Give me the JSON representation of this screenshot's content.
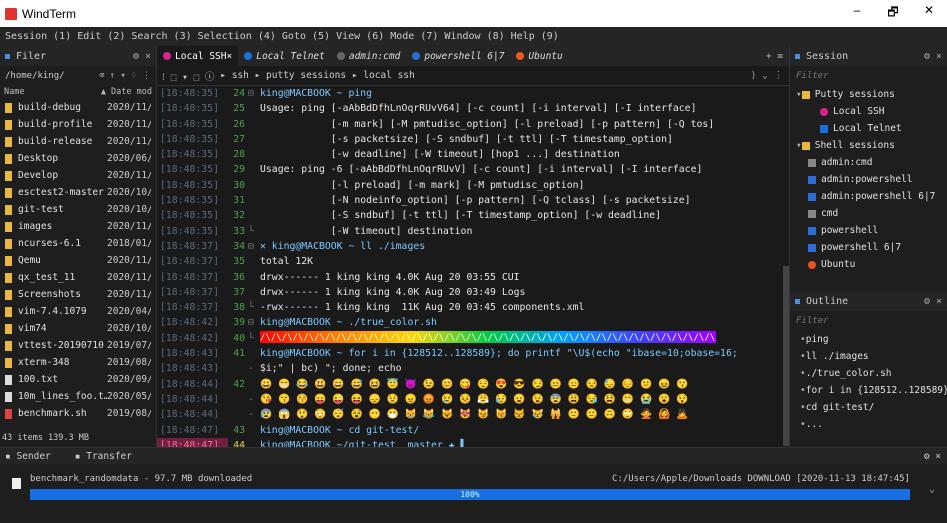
{
  "app": {
    "title": "WindTerm",
    "min": "–",
    "max": "🗗",
    "close": "✕"
  },
  "menu": [
    "Session (1)",
    "Edit (2)",
    "Search (3)",
    "Selection (4)",
    "Goto (5)",
    "View (6)",
    "Mode (7)",
    "Window (8)",
    "Help (9)"
  ],
  "filer": {
    "title": "Filer",
    "path": "/home/king/",
    "tools": "⌫ ↑ ▾ ♢ ⋮",
    "col_name": "Name",
    "col_date": "▲ Date mod",
    "files": [
      {
        "name": "build-debug",
        "date": "2020/11/",
        "type": "folder"
      },
      {
        "name": "build-profile",
        "date": "2020/11/",
        "type": "folder"
      },
      {
        "name": "build-release",
        "date": "2020/11/",
        "type": "folder"
      },
      {
        "name": "Desktop",
        "date": "2020/06/",
        "type": "folder"
      },
      {
        "name": "Develop",
        "date": "2020/11/",
        "type": "folder"
      },
      {
        "name": "esctest2-master",
        "date": "2020/10/",
        "type": "folder"
      },
      {
        "name": "git-test",
        "date": "2020/10/",
        "type": "folder"
      },
      {
        "name": "images",
        "date": "2020/11/",
        "type": "folder"
      },
      {
        "name": "ncurses-6.1",
        "date": "2018/01/",
        "type": "folder"
      },
      {
        "name": "Qemu",
        "date": "2020/11/",
        "type": "folder"
      },
      {
        "name": "qx_test_11",
        "date": "2020/11/",
        "type": "folder"
      },
      {
        "name": "Screenshots",
        "date": "2020/11/",
        "type": "folder"
      },
      {
        "name": "vim-7.4.1079",
        "date": "2020/04/",
        "type": "folder"
      },
      {
        "name": "vim74",
        "date": "2020/10/",
        "type": "folder"
      },
      {
        "name": "vttest-20190710",
        "date": "2019/07/",
        "type": "folder"
      },
      {
        "name": "xterm-348",
        "date": "2019/08/",
        "type": "folder"
      },
      {
        "name": "100.txt",
        "date": "2020/09/",
        "type": "file"
      },
      {
        "name": "10m_lines_foo.t…",
        "date": "2020/05/",
        "type": "file"
      },
      {
        "name": "benchmark.sh",
        "date": "2019/08/",
        "type": "script"
      }
    ],
    "footer": "43 items 139.3 MB"
  },
  "tabs": [
    {
      "label": "Local SSH",
      "color": "#e0208a",
      "active": true
    },
    {
      "label": "Local Telnet",
      "color": "#1a6fe0",
      "active": false
    },
    {
      "label": "admin:cmd",
      "color": "#666",
      "active": false
    },
    {
      "label": "powershell 6|7",
      "color": "#2b6fd6",
      "active": false
    },
    {
      "label": "Ubuntu",
      "color": "#e95420",
      "active": false
    }
  ],
  "tabtools": "+ ≡",
  "breadcrumbs": "▸ ssh ▸ putty sessions ▸ local ssh",
  "breadtools": "⟩ ⌄ ⋮",
  "terminal": [
    {
      "ts": "[18:48:35]",
      "ln": "24",
      "g": "⊟",
      "text": "king@MACBOOK ~ ping",
      "kind": "prompt"
    },
    {
      "ts": "[18:48:35]",
      "ln": "25",
      "g": "",
      "text": "Usage: ping [-aAbBdDfhLnOqrRUvV64] [-c count] [-i interval] [-I interface]"
    },
    {
      "ts": "[18:48:35]",
      "ln": "26",
      "g": "",
      "text": "            [-m mark] [-M pmtudisc_option] [-l preload] [-p pattern] [-Q tos]"
    },
    {
      "ts": "[18:48:35]",
      "ln": "27",
      "g": "",
      "text": "            [-s packetsize] [-S sndbuf] [-t ttl] [-T timestamp_option]"
    },
    {
      "ts": "[18:48:35]",
      "ln": "28",
      "g": "",
      "text": "            [-w deadline] [-W timeout] [hop1 ...] destination"
    },
    {
      "ts": "[18:48:35]",
      "ln": "29",
      "g": "",
      "text": "Usage: ping -6 [-aAbBdDfhLnOqrRUvV] [-c count] [-i interval] [-I interface]"
    },
    {
      "ts": "[18:48:35]",
      "ln": "30",
      "g": "",
      "text": "            [-l preload] [-m mark] [-M pmtudisc_option]"
    },
    {
      "ts": "[18:48:35]",
      "ln": "31",
      "g": "",
      "text": "            [-N nodeinfo_option] [-p pattern] [-Q tclass] [-s packetsize]"
    },
    {
      "ts": "[18:48:35]",
      "ln": "32",
      "g": "",
      "text": "            [-S sndbuf] [-t ttl] [-T timestamp_option] [-w deadline]"
    },
    {
      "ts": "[18:48:35]",
      "ln": "33",
      "g": "└",
      "text": "            [-W timeout] destination"
    },
    {
      "ts": "[18:48:37]",
      "ln": "34",
      "g": "⊟",
      "text": "✕ king@MACBOOK ~ ll ./images",
      "kind": "prompt"
    },
    {
      "ts": "[18:48:37]",
      "ln": "35",
      "g": "",
      "text": "total 12K"
    },
    {
      "ts": "[18:48:37]",
      "ln": "36",
      "g": "",
      "text": "drwx------ 1 king king 4.0K Aug 20 03:55 CUI"
    },
    {
      "ts": "[18:48:37]",
      "ln": "37",
      "g": "",
      "text": "drwx------ 1 king king 4.0K Aug 20 03:49 Logs"
    },
    {
      "ts": "[18:48:37]",
      "ln": "38",
      "g": "└",
      "text": "-rwx------ 1 king king  11K Aug 20 03:45 components.xml"
    },
    {
      "ts": "[18:48:42]",
      "ln": "39",
      "g": "⊟",
      "text": "king@MACBOOK ~ ./true_color.sh",
      "kind": "prompt"
    },
    {
      "ts": "[18:48:42]",
      "ln": "40",
      "g": "└",
      "text": "/\\/\\/\\/\\/\\/\\/\\/\\/\\/\\/\\/\\/\\/\\/\\/\\/\\/\\/\\/\\/\\/\\/\\/\\/\\/\\/\\/\\/\\/\\/\\/\\/\\/\\/\\/\\/\\/\\/\\/\\/\\/\\/\\/\\/\\/\\/\\/\\/\\",
      "kind": "rainbow"
    },
    {
      "ts": "[18:48:43]",
      "ln": "41",
      "g": "",
      "text": "king@MACBOOK ~ for i in {128512..128589}; do printf \"\\U$(echo \"ibase=10;obase=16;",
      "kind": "prompt"
    },
    {
      "ts": "[18:48:43]",
      "ln": "",
      "g": "-",
      "text": "$i;\" | bc) \"; done; echo"
    },
    {
      "ts": "[18:48:44]",
      "ln": "42",
      "g": "",
      "text": "😀 😁 😂 😃 😄 😅 😆 😇 😈 😉 😊 😋 😌 😍 😎 😏 😐 😑 😒 😓 😔 😕 😖 😗",
      "kind": "emoji"
    },
    {
      "ts": "[18:48:44]",
      "ln": "",
      "g": "-",
      "text": "😘 😙 😚 😛 😜 😝 😞 😟 😠 😡 😢 😣 😤 😥 😦 😧 😨 😩 😪 😫 😬 😭 😮 😯",
      "kind": "emoji"
    },
    {
      "ts": "[18:48:44]",
      "ln": "",
      "g": "-",
      "text": "😰 😱 😲 😳 😴 😵 😶 😷 😸 😹 😺 😻 😼 😽 😾 😿 🙀 🙁 🙂 🙃 🙄 🙅 🙆 🙇",
      "kind": "emoji"
    },
    {
      "ts": "[18:48:47]",
      "ln": "43",
      "g": "",
      "text": "king@MACBOOK ~ cd git-test/",
      "kind": "prompt"
    },
    {
      "ts": "[18:48:47]",
      "ln": "44",
      "g": "",
      "text": "king@MACBOOK ~/git-test  master ✚ ▌",
      "kind": "prompt",
      "current": true
    }
  ],
  "session": {
    "title": "Session",
    "filter": "Filter",
    "items": [
      {
        "label": "Putty sessions",
        "level": 0,
        "icon": "folder-icon"
      },
      {
        "label": "Local SSH",
        "level": 2,
        "icon": "ssh-icon"
      },
      {
        "label": "Local Telnet",
        "level": 2,
        "icon": "telnet-icon"
      },
      {
        "label": "Shell sessions",
        "level": 0,
        "icon": "folder-icon"
      },
      {
        "label": "admin:cmd",
        "level": 1,
        "icon": "cmd-icon"
      },
      {
        "label": "admin:powershell",
        "level": 1,
        "icon": "powershell-icon"
      },
      {
        "label": "admin:powershell 6|7",
        "level": 1,
        "icon": "powershell-icon"
      },
      {
        "label": "cmd",
        "level": 1,
        "icon": "cmd-icon"
      },
      {
        "label": "powershell",
        "level": 1,
        "icon": "powershell-icon"
      },
      {
        "label": "powershell 6|7",
        "level": 1,
        "icon": "powershell-icon"
      },
      {
        "label": "Ubuntu",
        "level": 1,
        "icon": "ubuntu-icon"
      }
    ]
  },
  "outline": {
    "title": "Outline",
    "filter": "Filter",
    "items": [
      "ping",
      "ll ./images",
      "./true_color.sh",
      "for i in {128512..128589}",
      "cd git-test/",
      "..."
    ]
  },
  "sender": {
    "tabs": [
      "Sender",
      "Transfer"
    ],
    "file": "benchmark_randomdata - 97.7 MB downloaded",
    "dest": "C:/Users/Apple/Downloads DOWNLOAD [2020-11-13 18:47:45]",
    "progress": "100%"
  },
  "colors": {
    "accent": "#1a6fe0",
    "folder": "#e8b93c",
    "prompt_blue": "#4a8fe0"
  }
}
